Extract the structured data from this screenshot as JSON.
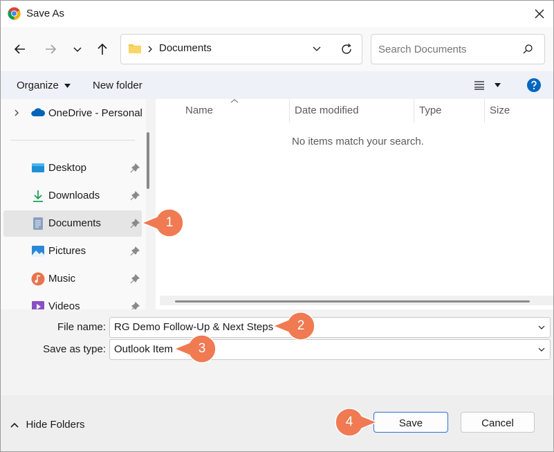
{
  "window": {
    "title": "Save As",
    "app_icon": "chrome-icon"
  },
  "address": {
    "folder": "Documents",
    "search_placeholder": "Search Documents"
  },
  "toolbar": {
    "organize": "Organize",
    "new_folder": "New folder"
  },
  "sidebar": {
    "onedrive": "OneDrive - Personal",
    "items": [
      {
        "label": "Desktop",
        "icon": "desktop-icon"
      },
      {
        "label": "Downloads",
        "icon": "download-icon"
      },
      {
        "label": "Documents",
        "icon": "documents-icon",
        "selected": true
      },
      {
        "label": "Pictures",
        "icon": "pictures-icon"
      },
      {
        "label": "Music",
        "icon": "music-icon"
      },
      {
        "label": "Videos",
        "icon": "videos-icon"
      }
    ]
  },
  "filelist": {
    "columns": [
      "Name",
      "Date modified",
      "Type",
      "Size"
    ],
    "empty_message": "No items match your search."
  },
  "form": {
    "file_name_label": "File name:",
    "file_name_value": "RG Demo Follow-Up & Next Steps",
    "save_type_label": "Save as type:",
    "save_type_value": "Outlook Item"
  },
  "footer": {
    "hide_folders": "Hide Folders",
    "save": "Save",
    "cancel": "Cancel"
  },
  "callouts": [
    "1",
    "2",
    "3",
    "4"
  ],
  "colors": {
    "callout": "#f07a52",
    "accent": "#0067c0",
    "selected_row": "#e5e5e5"
  }
}
